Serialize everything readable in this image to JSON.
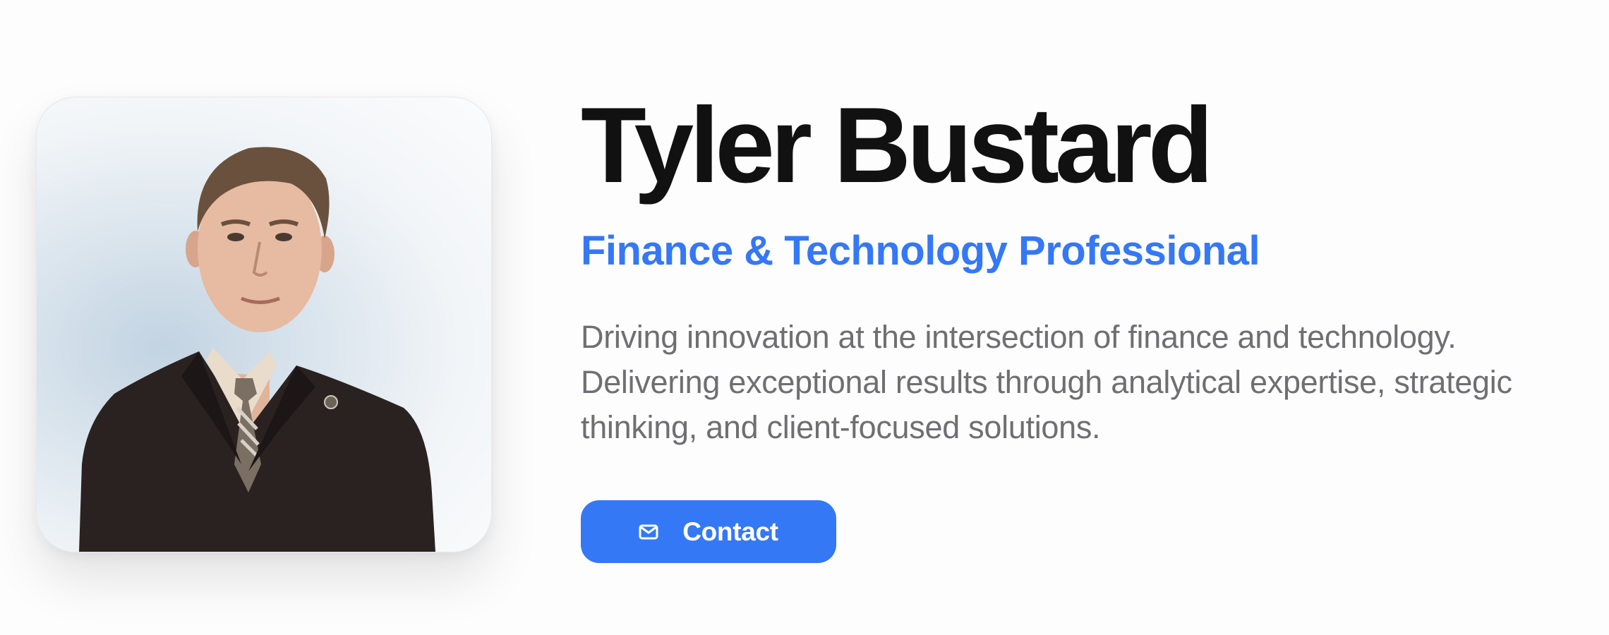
{
  "profile": {
    "name": "Tyler Bustard",
    "title": "Finance & Technology Professional",
    "description": "Driving innovation at the intersection of finance and technology. Delivering exceptional results through analytical expertise, strategic thinking, and client-focused solutions.",
    "photo_icon": "portrait-photo"
  },
  "actions": {
    "contact_label": "Contact",
    "contact_icon": "mail-icon"
  },
  "colors": {
    "accent": "#3478f6",
    "heading": "#111111",
    "body_text": "#6f6f73",
    "background": "#fdfdfd"
  }
}
